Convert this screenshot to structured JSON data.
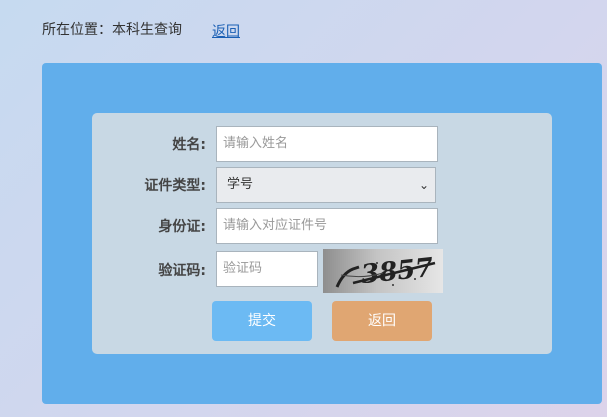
{
  "breadcrumb": {
    "text": "所在位置：本科生查询",
    "back_link": "返回"
  },
  "form": {
    "name_label": "姓名:",
    "name_placeholder": "请输入姓名",
    "id_type_label": "证件类型:",
    "id_type_value": "学号",
    "id_number_label": "身份证:",
    "id_number_placeholder": "请输入对应证件号",
    "captcha_label": "验证码:",
    "captcha_placeholder": "验证码",
    "captcha_text": "3857"
  },
  "buttons": {
    "submit": "提交",
    "back": "返回"
  },
  "colors": {
    "outer_panel": "#61aeeb",
    "inner_panel": "#c8d8e4",
    "submit_button": "#6cbaf3",
    "back_button": "#e0a672",
    "link": "#1a5fb4"
  }
}
